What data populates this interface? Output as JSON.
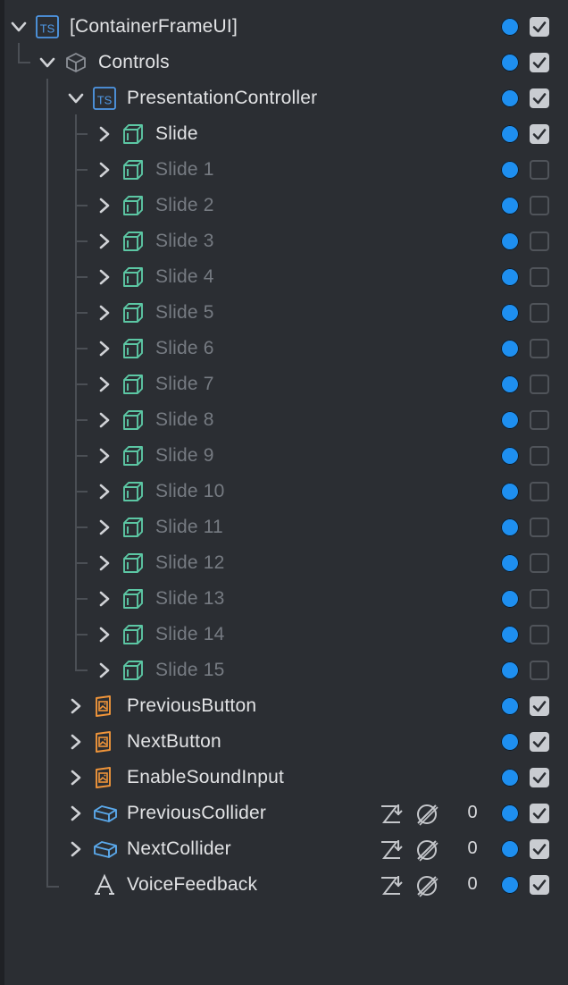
{
  "colors": {
    "background": "#2b2e33",
    "text_active": "#e2e3e5",
    "text_dim": "#767b82",
    "ts_icon": "#4f98e6",
    "object_icon": "#5cc7a4",
    "image_icon": "#f0953a",
    "collider_icon": "#5aa8ea",
    "dot": "#1e8ff0",
    "checkbox": "#c9ccd1"
  },
  "tree": [
    {
      "id": "cfui",
      "label": "[ContainerFrameUI]",
      "icon": "typescript-icon",
      "expanded": true,
      "depth": 0,
      "enabled": true,
      "dim": false
    },
    {
      "id": "controls",
      "label": "Controls",
      "icon": "scene-object-icon",
      "expanded": true,
      "depth": 1,
      "enabled": true,
      "dim": false
    },
    {
      "id": "presentation",
      "label": "PresentationController",
      "icon": "typescript-icon",
      "expanded": true,
      "depth": 2,
      "enabled": true,
      "dim": false
    },
    {
      "id": "slide",
      "label": "Slide",
      "icon": "object-icon",
      "expanded": false,
      "depth": 3,
      "enabled": true,
      "dim": false
    },
    {
      "id": "slide-1",
      "label": "Slide 1",
      "icon": "object-icon",
      "expanded": false,
      "depth": 3,
      "enabled": false,
      "dim": true
    },
    {
      "id": "slide-2",
      "label": "Slide 2",
      "icon": "object-icon",
      "expanded": false,
      "depth": 3,
      "enabled": false,
      "dim": true
    },
    {
      "id": "slide-3",
      "label": "Slide 3",
      "icon": "object-icon",
      "expanded": false,
      "depth": 3,
      "enabled": false,
      "dim": true
    },
    {
      "id": "slide-4",
      "label": "Slide 4",
      "icon": "object-icon",
      "expanded": false,
      "depth": 3,
      "enabled": false,
      "dim": true
    },
    {
      "id": "slide-5",
      "label": "Slide 5",
      "icon": "object-icon",
      "expanded": false,
      "depth": 3,
      "enabled": false,
      "dim": true
    },
    {
      "id": "slide-6",
      "label": "Slide 6",
      "icon": "object-icon",
      "expanded": false,
      "depth": 3,
      "enabled": false,
      "dim": true
    },
    {
      "id": "slide-7",
      "label": "Slide 7",
      "icon": "object-icon",
      "expanded": false,
      "depth": 3,
      "enabled": false,
      "dim": true
    },
    {
      "id": "slide-8",
      "label": "Slide 8",
      "icon": "object-icon",
      "expanded": false,
      "depth": 3,
      "enabled": false,
      "dim": true
    },
    {
      "id": "slide-9",
      "label": "Slide 9",
      "icon": "object-icon",
      "expanded": false,
      "depth": 3,
      "enabled": false,
      "dim": true
    },
    {
      "id": "slide-10",
      "label": "Slide 10",
      "icon": "object-icon",
      "expanded": false,
      "depth": 3,
      "enabled": false,
      "dim": true
    },
    {
      "id": "slide-11",
      "label": "Slide 11",
      "icon": "object-icon",
      "expanded": false,
      "depth": 3,
      "enabled": false,
      "dim": true
    },
    {
      "id": "slide-12",
      "label": "Slide 12",
      "icon": "object-icon",
      "expanded": false,
      "depth": 3,
      "enabled": false,
      "dim": true
    },
    {
      "id": "slide-13",
      "label": "Slide 13",
      "icon": "object-icon",
      "expanded": false,
      "depth": 3,
      "enabled": false,
      "dim": true
    },
    {
      "id": "slide-14",
      "label": "Slide 14",
      "icon": "object-icon",
      "expanded": false,
      "depth": 3,
      "enabled": false,
      "dim": true
    },
    {
      "id": "slide-15",
      "label": "Slide 15",
      "icon": "object-icon",
      "expanded": false,
      "depth": 3,
      "enabled": false,
      "dim": true
    },
    {
      "id": "prev-button",
      "label": "PreviousButton",
      "icon": "image-icon",
      "expanded": false,
      "depth": 2,
      "enabled": true,
      "dim": false
    },
    {
      "id": "next-button",
      "label": "NextButton",
      "icon": "image-icon",
      "expanded": false,
      "depth": 2,
      "enabled": true,
      "dim": false
    },
    {
      "id": "sound-input",
      "label": "EnableSoundInput",
      "icon": "image-icon",
      "expanded": false,
      "depth": 2,
      "enabled": true,
      "dim": false
    },
    {
      "id": "prev-collider",
      "label": "PreviousCollider",
      "icon": "collider-icon",
      "expanded": false,
      "depth": 2,
      "enabled": true,
      "dim": false,
      "layer_count": "0"
    },
    {
      "id": "next-collider",
      "label": "NextCollider",
      "icon": "collider-icon",
      "expanded": false,
      "depth": 2,
      "enabled": true,
      "dim": false,
      "layer_count": "0"
    },
    {
      "id": "voice-feedback",
      "label": "VoiceFeedback",
      "icon": "text-icon",
      "expanded": null,
      "depth": 2,
      "enabled": true,
      "dim": false,
      "layer_count": "0"
    }
  ]
}
